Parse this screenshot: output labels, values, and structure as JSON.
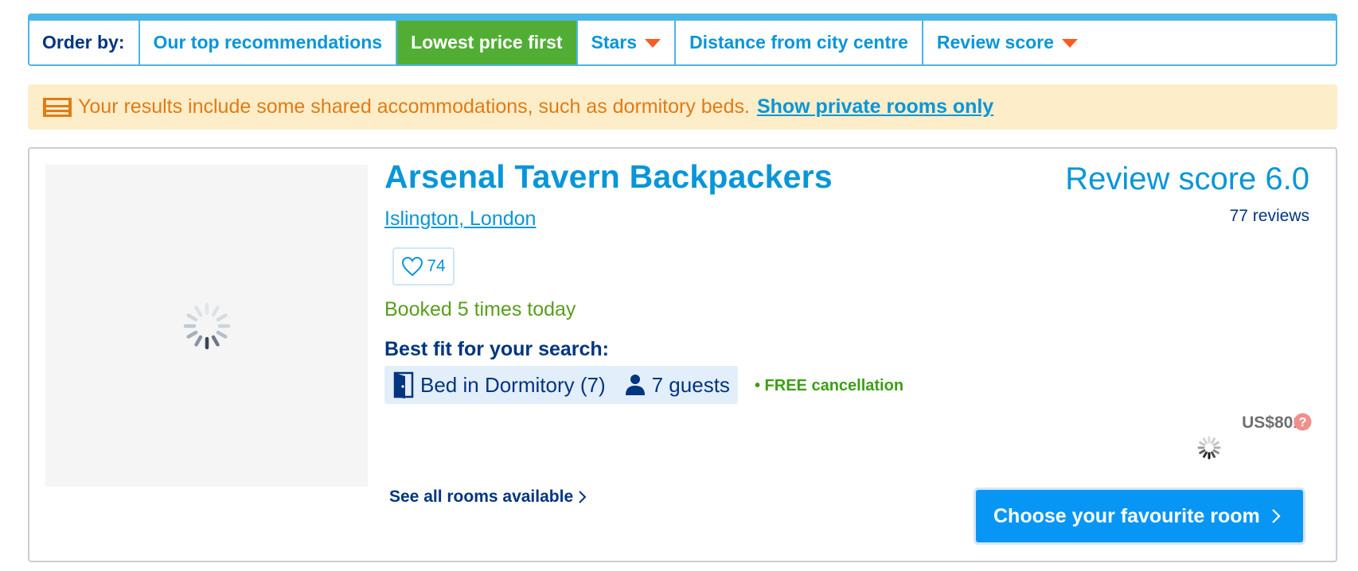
{
  "order_bar": {
    "label": "Order by:",
    "options": [
      {
        "label": "Our top recommendations",
        "active": false,
        "has_caret": false
      },
      {
        "label": "Lowest price first",
        "active": true,
        "has_caret": false
      },
      {
        "label": "Stars",
        "active": false,
        "has_caret": true
      },
      {
        "label": "Distance from city centre",
        "active": false,
        "has_caret": false
      },
      {
        "label": "Review score",
        "active": false,
        "has_caret": true
      }
    ]
  },
  "notice": {
    "text": "Your results include some shared accommodations, such as dormitory beds.",
    "link": "Show private rooms only",
    "icon": "bed-icon"
  },
  "hotel": {
    "name": "Arsenal Tavern Backpackers",
    "location": "Islington, London",
    "wishlist_count": "74",
    "booked_text": "Booked 5 times today",
    "best_fit_label": "Best fit for your search:",
    "room_type": "Bed in Dormitory (7)",
    "guests": "7 guests",
    "free_cancellation": "• FREE cancellation",
    "see_all": "See all rooms available",
    "review_score": "Review score 6.0",
    "review_count": "77 reviews",
    "price": "US$801",
    "cta": "Choose your favourite room"
  },
  "colors": {
    "brand_blue": "#0896d8",
    "dark_blue": "#003580",
    "active_green": "#52ad35",
    "caret_orange": "#ff5a1f",
    "notice_bg": "#fdedc9",
    "notice_text": "#e07b15",
    "cta_blue": "#0896f4"
  }
}
